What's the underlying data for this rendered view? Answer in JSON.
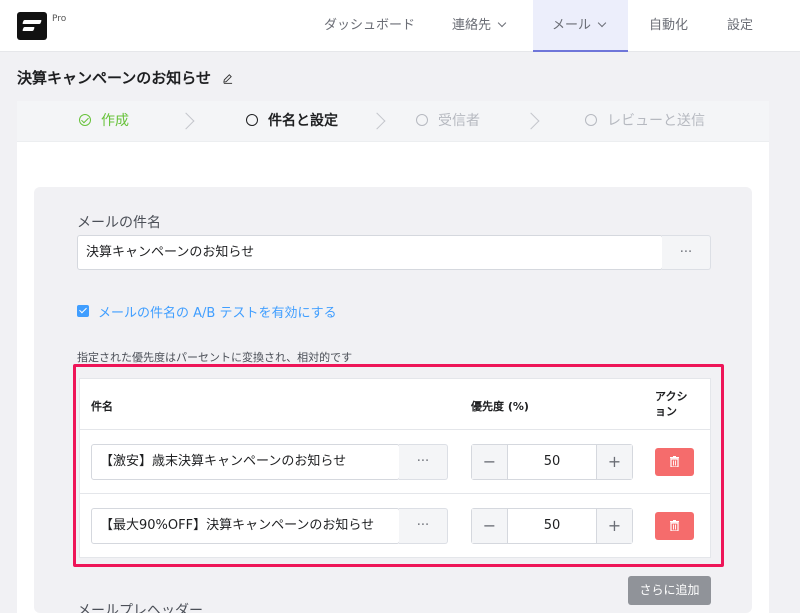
{
  "app": {
    "badge": "Pro"
  },
  "nav": {
    "items": [
      {
        "label": "ダッシュボード"
      },
      {
        "label": "連絡先"
      },
      {
        "label": "メール"
      },
      {
        "label": "自動化"
      },
      {
        "label": "設定"
      }
    ],
    "active": "メール"
  },
  "page": {
    "title": "決算キャンペーンのお知らせ"
  },
  "steps": [
    {
      "label": "作成",
      "state": "done"
    },
    {
      "label": "件名と設定",
      "state": "current"
    },
    {
      "label": "受信者",
      "state": "pending"
    },
    {
      "label": "レビューと送信",
      "state": "pending"
    }
  ],
  "subject": {
    "label": "メールの件名",
    "value": "決算キャンペーンのお知らせ",
    "more": "···"
  },
  "ab_test": {
    "checked": true,
    "label": "メールの件名の A/B テストを有効にする",
    "note": "指定された優先度はパーセントに変換され、相対的です"
  },
  "table": {
    "headers": {
      "subject": "件名",
      "priority": "優先度 (%)",
      "action": "アクション"
    },
    "rows": [
      {
        "subject": "【激安】歳末決算キャンペーンのお知らせ",
        "priority": "50"
      },
      {
        "subject": "【最大90%OFF】決算キャンペーンのお知らせ",
        "priority": "50"
      }
    ],
    "more": "···",
    "minus": "−",
    "plus": "+"
  },
  "add_more": {
    "label": "さらに追加"
  },
  "preheader": {
    "label": "メールプレヘッダー"
  },
  "colors": {
    "accent": "#409eff",
    "success": "#67c23a",
    "danger": "#f56c6c",
    "highlight": "#ee1558"
  }
}
